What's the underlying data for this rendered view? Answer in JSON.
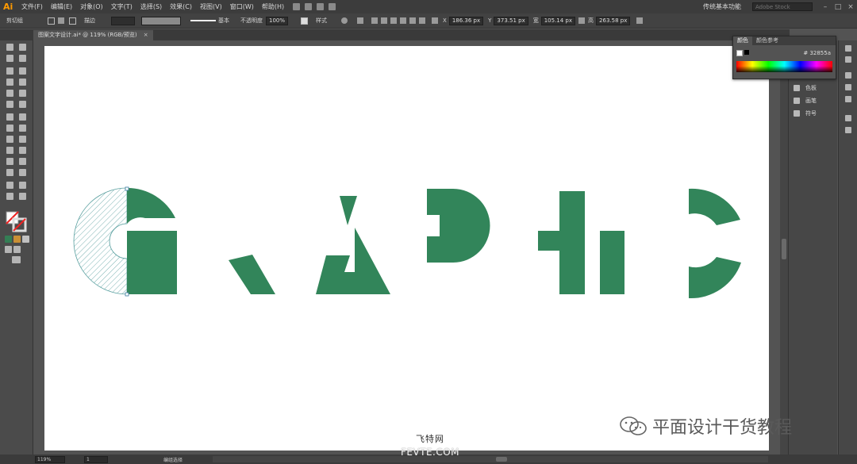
{
  "app": {
    "logo": "Ai"
  },
  "menubar": {
    "items": [
      "文件(F)",
      "编辑(E)",
      "对象(O)",
      "文字(T)",
      "选择(S)",
      "效果(C)",
      "视图(V)",
      "窗口(W)",
      "帮助(H)"
    ],
    "workspace": "传统基本功能",
    "search_placeholder": "Adobe Stock",
    "window_controls": [
      "–",
      "□",
      "×"
    ]
  },
  "controlbar": {
    "selection_label": "剪切组",
    "stroke_style": "描边",
    "stroke_profile": "基本",
    "opacity_label": "不透明度",
    "opacity_value": "100%",
    "style_label": "样式",
    "x_label": "X",
    "x_value": "186.36 px",
    "y_label": "Y",
    "y_value": "373.51 px",
    "w_label": "宽",
    "w_value": "105.14 px",
    "h_label": "高",
    "h_value": "263.58 px"
  },
  "document": {
    "tab_title": "图案文字设计.ai* @ 119% (RGB/预览)",
    "close_label": "×"
  },
  "color_panel": {
    "tabs": [
      "颜色",
      "颜色参考"
    ],
    "hex_label": "#",
    "hex_value": "32855a",
    "fill_color": "#32855a"
  },
  "dock": {
    "items": [
      {
        "icon": "swatches-icon",
        "label": "色板"
      },
      {
        "icon": "brush-icon",
        "label": "画笔"
      },
      {
        "icon": "symbol-icon",
        "label": "符号"
      }
    ]
  },
  "artwork": {
    "letters": [
      "G",
      "R",
      "A",
      "P",
      "H",
      "I",
      "C"
    ],
    "letter_color": "#32855a",
    "hatch_color": "#5aa0a0"
  },
  "statusbar": {
    "zoom": "119%",
    "artboard": "1",
    "tool_name": "编组选择"
  },
  "watermarks": {
    "brand_text": "平面设计干货教程",
    "site_cn": "飞特网",
    "site_en": "FEVTE.COM"
  }
}
